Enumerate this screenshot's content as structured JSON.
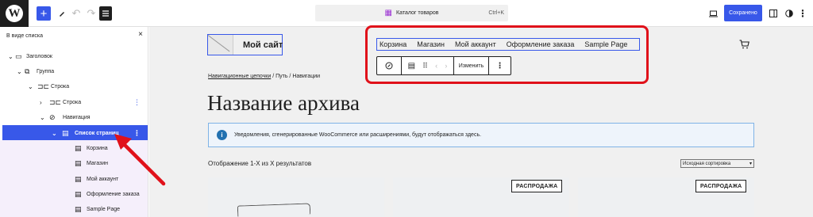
{
  "toolbar": {
    "logo": "W",
    "add": "+",
    "command_label": "Каталог товаров",
    "command_shortcut": "Ctrl+K",
    "save": "Сохранено"
  },
  "sidebar": {
    "title": "В виде списка",
    "close": "×",
    "items": [
      {
        "label": "Заголовок",
        "icon": "header-icon"
      },
      {
        "label": "Группа",
        "icon": "group-icon"
      },
      {
        "label": "Строка",
        "icon": "row-icon"
      },
      {
        "label": "Строка",
        "icon": "row-icon"
      },
      {
        "label": "Навигация",
        "icon": "navigation-icon"
      },
      {
        "label": "Список страниц",
        "icon": "page-list-icon"
      },
      {
        "label": "Корзина",
        "icon": "page-icon"
      },
      {
        "label": "Магазин",
        "icon": "page-icon"
      },
      {
        "label": "Мой аккаунт",
        "icon": "page-icon"
      },
      {
        "label": "Оформление заказа",
        "icon": "page-icon"
      },
      {
        "label": "Sample Page",
        "icon": "page-icon"
      }
    ]
  },
  "site": {
    "title": "Мой сайт",
    "nav": [
      "Корзина",
      "Магазин",
      "Мой аккаунт",
      "Оформление заказа",
      "Sample Page"
    ]
  },
  "block_toolbar": {
    "edit": "Изменить"
  },
  "breadcrumb": {
    "link": "Навигационные цепочки",
    "rest": " / Путь / Навигации"
  },
  "archive_title": "Название архива",
  "notice": "Уведомления, сгенерированные WooCommerce или расширениями, будут отображаться здесь.",
  "results": "Отображение 1-X из X результатов",
  "sort": "Исходная сортировка",
  "products": [
    {
      "badge": ""
    },
    {
      "badge": "РАСПРОДАЖА"
    },
    {
      "badge": "РАСПРОДАЖА"
    }
  ],
  "colors": {
    "accent": "#3858e9",
    "highlight": "#e0111a",
    "template": "#9c33d3"
  }
}
